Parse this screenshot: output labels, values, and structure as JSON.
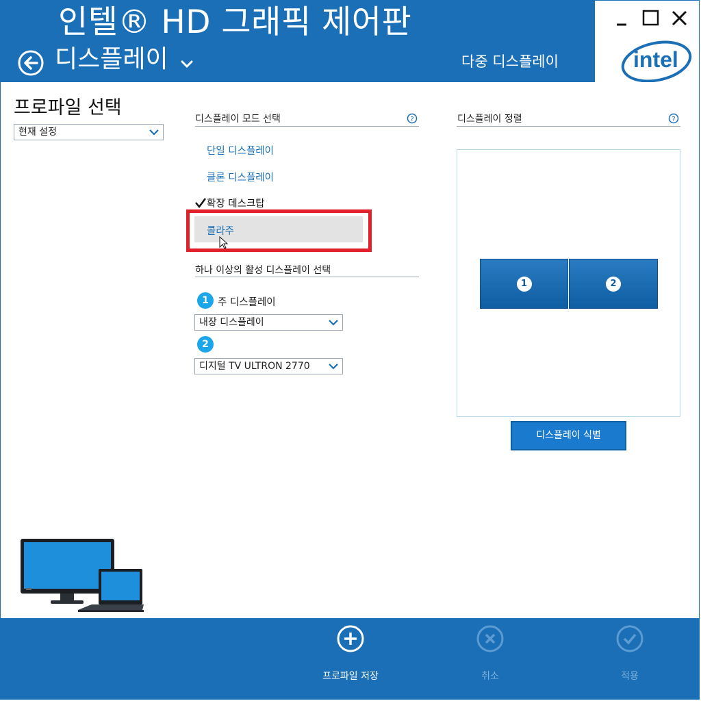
{
  "window": {
    "app_title": "인텔® HD 그래픽 제어판",
    "page_title": "디스플레이",
    "section_tab": "다중 디스플레이",
    "logo_text": "intel",
    "accent": "#1a6fb6"
  },
  "profile": {
    "title": "프로파일 선택",
    "selected": "현재 설정"
  },
  "mode": {
    "heading": "디스플레이 모드 선택",
    "options": [
      {
        "label": "단일 디스플레이",
        "checked": false
      },
      {
        "label": "클론 디스플레이",
        "checked": false
      },
      {
        "label": "확장 데스크탑",
        "checked": true
      },
      {
        "label": "콜라주",
        "checked": false,
        "highlighted": true
      }
    ]
  },
  "active": {
    "heading": "하나 이상의 활성 디스플레이 선택",
    "primary_label": "주 디스플레이",
    "display1": {
      "number": "1",
      "selected": "내장 디스플레이"
    },
    "display2": {
      "number": "2",
      "selected": "디지털 TV ULTRON 2770"
    }
  },
  "arrangement": {
    "heading": "디스플레이 정렬",
    "monitors": [
      "1",
      "2"
    ],
    "identify_label": "디스플레이 식별"
  },
  "footer": {
    "save_label": "프로파일 저장",
    "cancel_label": "취소",
    "apply_label": "적용"
  }
}
